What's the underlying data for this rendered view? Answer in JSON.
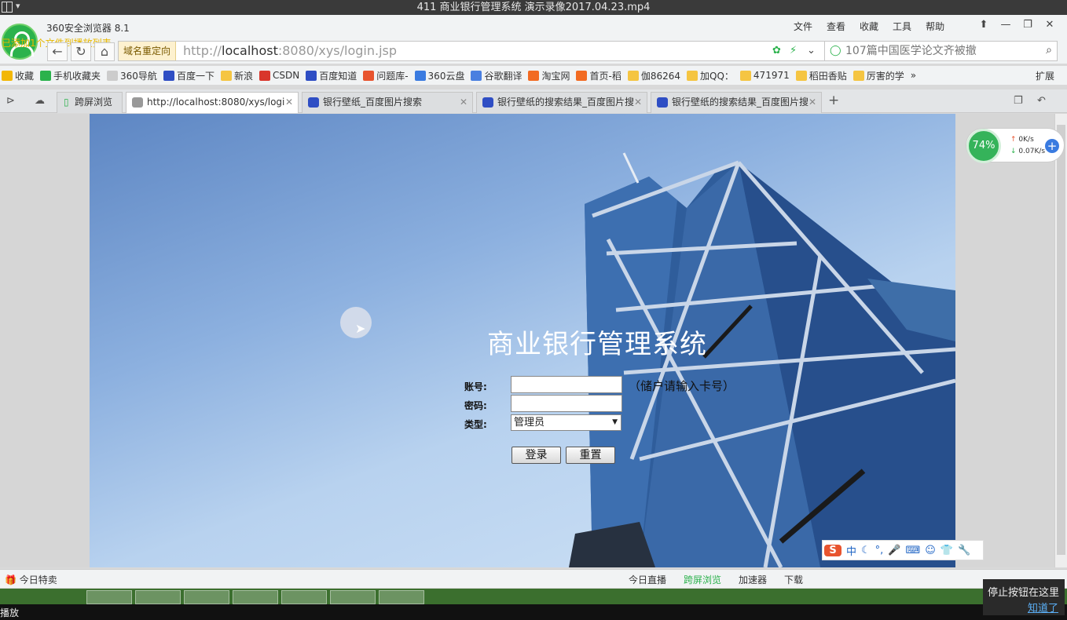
{
  "player": {
    "title": "411 商业银行管理系统  演示录像2017.04.23.mp4"
  },
  "browser": {
    "name": "360安全浏览器 8.1",
    "overlay_message": "已添加1个文件到播放列表",
    "menu": [
      "文件",
      "查看",
      "收藏",
      "工具",
      "帮助"
    ],
    "redirect_badge": "域名重定向",
    "url_prefix": "http://",
    "url_host": "localhost",
    "url_rest": ":8080/xys/login.jsp",
    "search_text": "107篇中国医学论文齐被撤"
  },
  "bookmarks": {
    "items": [
      {
        "label": "收藏",
        "color": "#f2b705"
      },
      {
        "label": "手机收藏夹",
        "color": "#2bb24c"
      },
      {
        "label": "360导航",
        "color": "#cccccc"
      },
      {
        "label": "百度一下",
        "color": "#2f4ec4"
      },
      {
        "label": "新浪",
        "color": "#f5c542"
      },
      {
        "label": "CSDN",
        "color": "#d9362b"
      },
      {
        "label": "百度知道",
        "color": "#2f4ec4"
      },
      {
        "label": "问题库-",
        "color": "#e8542e"
      },
      {
        "label": "360云盘",
        "color": "#3a7be0"
      },
      {
        "label": "谷歌翻译",
        "color": "#4a7fe0"
      },
      {
        "label": "淘宝网",
        "color": "#f26b22"
      },
      {
        "label": "首页-稻",
        "color": "#f26b22"
      },
      {
        "label": "伽86264",
        "color": "#f5c542"
      },
      {
        "label": "加QQ：",
        "color": "#f5c542"
      },
      {
        "label": "471971",
        "color": "#f5c542"
      },
      {
        "label": "稻田香贴",
        "color": "#f5c542"
      },
      {
        "label": "厉害的学",
        "color": "#f5c542"
      }
    ],
    "more": "»",
    "extend": "扩展"
  },
  "tabs": {
    "cross_screen": "跨屏浏览",
    "items": [
      {
        "label": "http://localhost:8080/xys/logi"
      },
      {
        "label": "银行壁纸_百度图片搜索"
      },
      {
        "label": "银行壁纸的搜索结果_百度图片搜"
      },
      {
        "label": "银行壁纸的搜索结果_百度图片搜"
      }
    ]
  },
  "login": {
    "title": "商业银行管理系统",
    "account_label": "账号:",
    "password_label": "密码:",
    "type_label": "类型:",
    "account_value": "",
    "password_value": "",
    "type_selected": "管理员",
    "hint": "（储户请输入卡号）",
    "login_button": "登录",
    "reset_button": "重置"
  },
  "speed_widget": {
    "percent": "74%",
    "up": "0K/s",
    "down": "0.07K/s"
  },
  "ime": {
    "logo": "S",
    "mode": "中"
  },
  "statusbar": {
    "left": "今日特卖",
    "items": [
      "今日直播",
      "跨屏浏览",
      "加速器",
      "下载"
    ]
  },
  "popup": {
    "text": "停止按钮在这里",
    "ok": "知道了"
  },
  "bottom": {
    "play": "播放"
  },
  "colors": {
    "accent": "#2bb24c",
    "hero_sky": "#8cb0df"
  }
}
